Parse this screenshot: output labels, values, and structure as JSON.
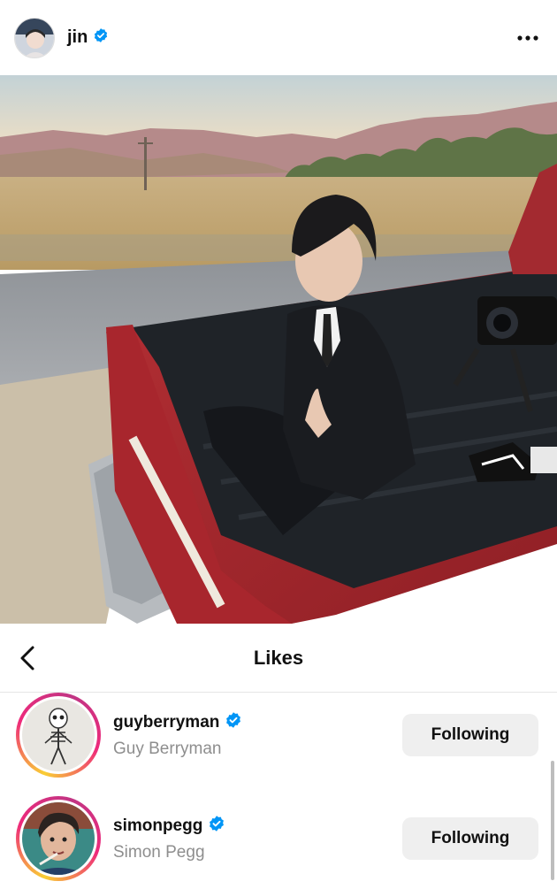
{
  "post": {
    "username": "jin",
    "more_icon": "more-horizontal-icon"
  },
  "likes": {
    "title": "Likes",
    "back_icon": "chevron-left-icon",
    "users": [
      {
        "handle": "guyberryman",
        "full_name": "Guy Berryman",
        "verified": true,
        "button_label": "Following"
      },
      {
        "handle": "simonpegg",
        "full_name": "Simon Pegg",
        "verified": true,
        "button_label": "Following"
      }
    ]
  },
  "colors": {
    "verified_blue": "#0095f6",
    "button_gray": "#efefef",
    "story_ring_gradient": [
      "#f9ce34",
      "#ee2a7b",
      "#c13584"
    ]
  }
}
